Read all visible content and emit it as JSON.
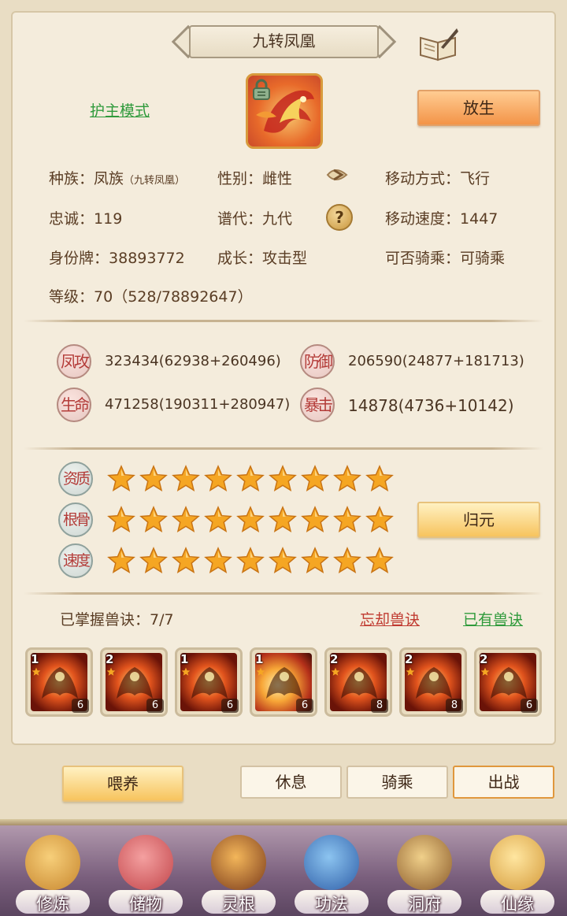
{
  "header": {
    "title": "九转凤凰"
  },
  "mode": {
    "guard_mode": "护主模式"
  },
  "buttons": {
    "release": "放生",
    "return_origin": "归元",
    "feed": "喂养",
    "rest": "休息",
    "ride": "骑乘",
    "battle": "出战"
  },
  "info": {
    "race_label": "种族：",
    "race_value": "凤族",
    "race_sub": "（九转凤凰）",
    "gender_label": "性别：",
    "gender_value": "雌性",
    "move_mode_label": "移动方式：",
    "move_mode_value": "飞行",
    "loyalty_label": "忠诚：",
    "loyalty_value": "119",
    "generation_label": "谱代：",
    "generation_value": "九代",
    "move_speed_label": "移动速度：",
    "move_speed_value": "1447",
    "id_label": "身份牌：",
    "id_value": "38893772",
    "growth_label": "成长：",
    "growth_value": "攻击型",
    "rideable_label": "可否骑乘：",
    "rideable_value": "可骑乘",
    "level_label": "等级：",
    "level_value": "70（528/78892647）"
  },
  "stats": [
    {
      "badge": "凤攻",
      "value": "323434(62938+260496)"
    },
    {
      "badge": "防御",
      "value": "206590(24877+181713)"
    },
    {
      "badge": "生命",
      "value": "471258(190311+280947)"
    },
    {
      "badge": "暴击",
      "value": "14878(4736+10142)"
    }
  ],
  "aptitudes": [
    {
      "badge": "资质",
      "stars": 9
    },
    {
      "badge": "根骨",
      "stars": 9
    },
    {
      "badge": "速度",
      "stars": 9
    }
  ],
  "skills_header": {
    "label": "已掌握兽诀：7/7",
    "forget": "忘却兽诀",
    "owned": "已有兽诀"
  },
  "skills": [
    {
      "level": "1",
      "count": "6",
      "icon": "phoenix-skill-icon"
    },
    {
      "level": "2",
      "count": "6",
      "icon": "phoenix-skill-icon"
    },
    {
      "level": "1",
      "count": "6",
      "icon": "phoenix-skill-icon"
    },
    {
      "level": "1",
      "count": "6",
      "icon": "flame-bird-skill-icon"
    },
    {
      "level": "2",
      "count": "8",
      "icon": "phoenix-skill-icon"
    },
    {
      "level": "2",
      "count": "8",
      "icon": "phoenix-skill-icon"
    },
    {
      "level": "2",
      "count": "6",
      "icon": "phoenix-skill-icon"
    }
  ],
  "nav": [
    {
      "label": "修炼",
      "icon": "monk-icon"
    },
    {
      "label": "储物",
      "icon": "treasure-bag-icon"
    },
    {
      "label": "灵根",
      "icon": "spirit-root-icon"
    },
    {
      "label": "功法",
      "icon": "book-icon"
    },
    {
      "label": "洞府",
      "icon": "palace-icon"
    },
    {
      "label": "仙缘",
      "icon": "gourd-icon"
    }
  ],
  "colors": {
    "accent_orange": "#f39448",
    "gold": "#f7c45e",
    "green_link": "#2f9a3b",
    "red_link": "#c03a30",
    "star": "#f5a623"
  }
}
